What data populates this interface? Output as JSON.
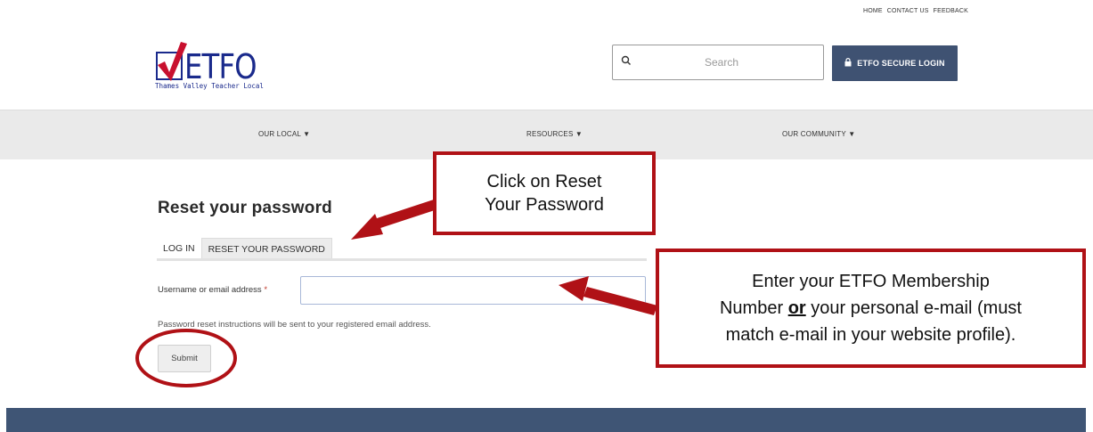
{
  "utility_nav": [
    "HOME",
    "CONTACT US",
    "FEEDBACK"
  ],
  "logo": {
    "text": "ETFO",
    "subtitle": "Thames Valley Teacher Local"
  },
  "search": {
    "placeholder": "Search",
    "icon": "search-icon"
  },
  "secure_login": {
    "label": "ETFO SECURE LOGIN",
    "icon": "lock-icon"
  },
  "main_nav": [
    {
      "label": "OUR LOCAL ▼"
    },
    {
      "label": "RESOURCES ▼"
    },
    {
      "label": "OUR COMMUNITY ▼"
    }
  ],
  "page_title": "Reset your password",
  "tabs": [
    {
      "label": "LOG IN",
      "active": false
    },
    {
      "label": "RESET YOUR PASSWORD",
      "active": true
    }
  ],
  "form": {
    "field_label": "Username or email address",
    "required_marker": "*",
    "value": "",
    "help_text": "Password reset instructions will be sent to your registered email address.",
    "submit_label": "Submit"
  },
  "annotations": {
    "callout_1": {
      "line1": "Click on Reset",
      "line2": "Your Password"
    },
    "callout_2": {
      "line1": "Enter your ETFO Membership",
      "line2_a": "Number ",
      "line2_b": "or",
      "line2_c": " your personal e-mail (must",
      "line3": "match e-mail in your website profile)."
    }
  },
  "colors": {
    "brand_blue": "#1a2a8c",
    "check_red": "#c8102e",
    "login_button": "#3f5272",
    "footer": "#3f5575",
    "annotation_red": "#b01116"
  }
}
